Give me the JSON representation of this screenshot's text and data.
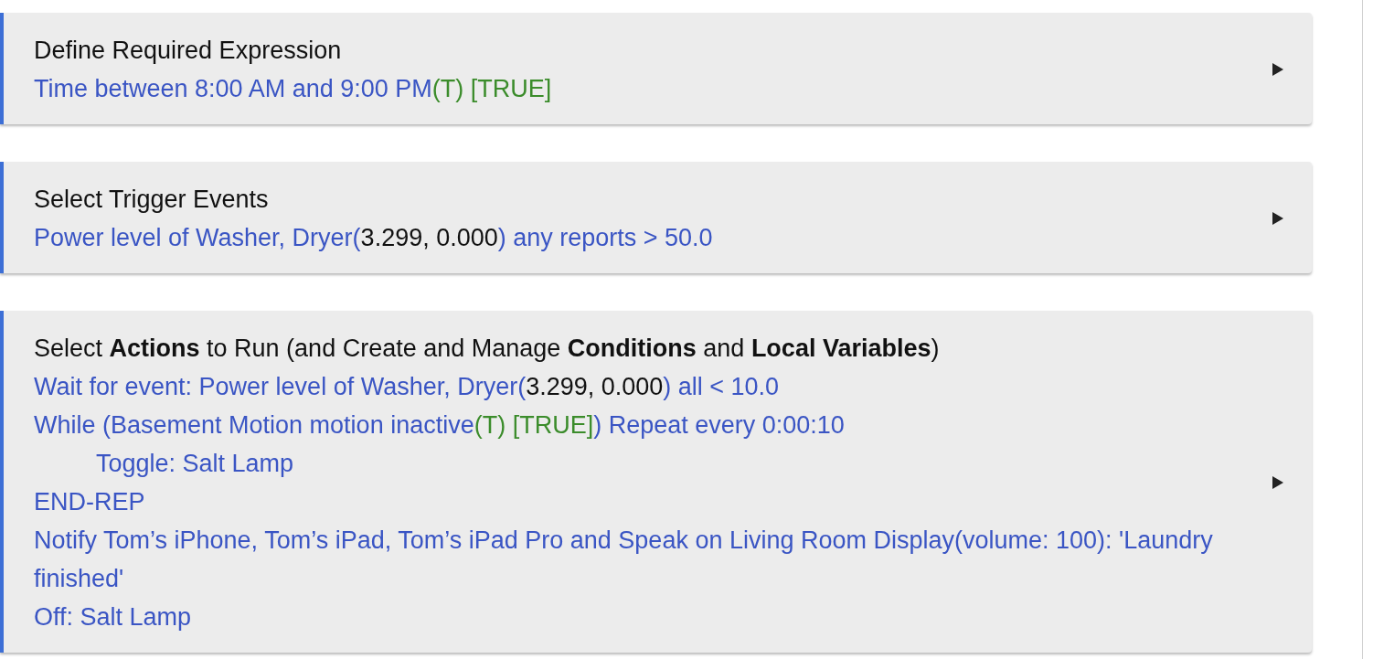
{
  "cards": [
    {
      "title": "Define Required Expression",
      "lines": [
        {
          "segments": [
            {
              "kind": "link",
              "text": "Time between 8:00 AM and 9:00 PM"
            },
            {
              "kind": "truth",
              "text": "(T) [TRUE]"
            }
          ]
        }
      ]
    },
    {
      "title": "Select Trigger Events",
      "lines": [
        {
          "segments": [
            {
              "kind": "link",
              "text": "Power level of Washer, Dryer("
            },
            {
              "kind": "value",
              "text": "3.299, 0.000"
            },
            {
              "kind": "link",
              "text": ") any reports > 50.0"
            }
          ]
        }
      ]
    },
    {
      "title": "Select **Actions** to Run (and Create and Manage **Conditions** and **Local Variables**)",
      "lines": [
        {
          "segments": [
            {
              "kind": "link",
              "text": "Wait for event: Power level of Washer, Dryer("
            },
            {
              "kind": "value",
              "text": "3.299, 0.000"
            },
            {
              "kind": "link",
              "text": ") all < 10.0"
            }
          ]
        },
        {
          "segments": [
            {
              "kind": "link",
              "text": "While (Basement Motion motion inactive"
            },
            {
              "kind": "truth",
              "text": "(T) [TRUE]"
            },
            {
              "kind": "link",
              "text": ") Repeat every 0:00:10"
            }
          ],
          "children": [
            {
              "segments": [
                {
                  "kind": "link",
                  "text": "Toggle: Salt Lamp"
                }
              ]
            }
          ]
        },
        {
          "segments": [
            {
              "kind": "link",
              "text": "END-REP"
            }
          ]
        },
        {
          "segments": [
            {
              "kind": "link",
              "text": "Notify Tom’s iPhone, Tom’s iPad, Tom’s iPad Pro and Speak on Living Room Display(volume: 100): 'Laundry finished'"
            }
          ]
        },
        {
          "segments": [
            {
              "kind": "link",
              "text": "Off: Salt Lamp"
            }
          ]
        }
      ]
    }
  ]
}
